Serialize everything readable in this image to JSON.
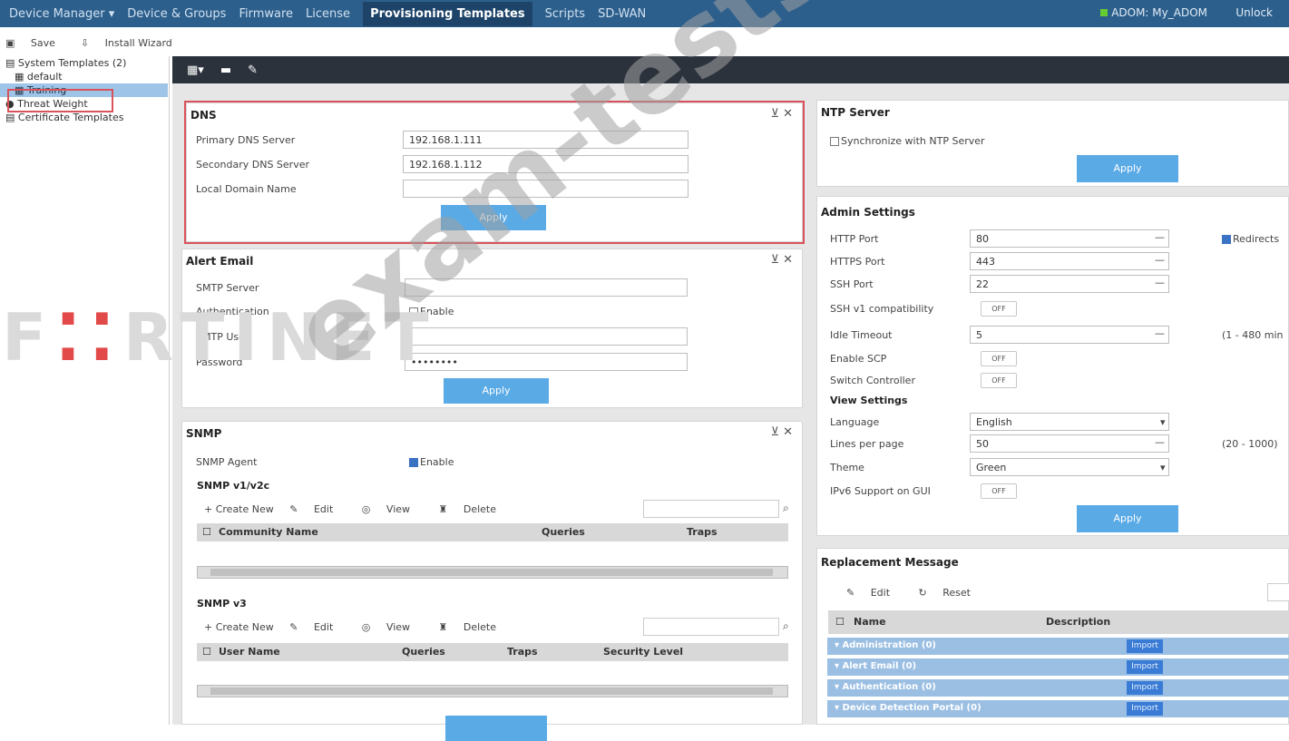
{
  "topnav": {
    "items": [
      "Device Manager ▾",
      "Device & Groups",
      "Firmware",
      "License",
      "Provisioning Templates",
      "Scripts",
      "SD-WAN"
    ],
    "active_index": 4,
    "adom": "ADOM: My_ADOM",
    "unlock": "Unlock"
  },
  "actions": {
    "save": "Save",
    "install": "Install Wizard"
  },
  "tree": {
    "items": [
      "System Templates (2)",
      "default",
      "Training",
      "Threat Weight",
      "Certificate Templates"
    ],
    "selected_index": 2
  },
  "dns": {
    "title": "DNS",
    "primary_label": "Primary DNS Server",
    "primary_value": "192.168.1.111",
    "secondary_label": "Secondary DNS Server",
    "secondary_value": "192.168.1.112",
    "domain_label": "Local Domain Name",
    "domain_value": "",
    "apply": "Apply"
  },
  "alert": {
    "title": "Alert Email",
    "smtp_label": "SMTP Server",
    "auth_label": "Authentication",
    "auth_check": "Enable",
    "user_label": "SMTP User",
    "password_label": "Password",
    "password_value": "••••••••",
    "apply": "Apply"
  },
  "snmp": {
    "title": "SNMP",
    "agent_label": "SNMP Agent",
    "agent_check": "Enable",
    "v12_title": "SNMP v1/v2c",
    "toolbar": [
      "+ Create New",
      "Edit",
      "View",
      "Delete"
    ],
    "v12_cols": [
      "Community Name",
      "Queries",
      "Traps"
    ],
    "v3_title": "SNMP v3",
    "v3_cols": [
      "User Name",
      "Queries",
      "Traps",
      "Security Level"
    ]
  },
  "ntp": {
    "title": "NTP Server",
    "sync_label": "Synchronize with NTP Server",
    "apply": "Apply"
  },
  "admin": {
    "title": "Admin Settings",
    "http_label": "HTTP Port",
    "http_value": "80",
    "redirect_label": "Redirects",
    "https_label": "HTTPS Port",
    "https_value": "443",
    "ssh_label": "SSH Port",
    "ssh_value": "22",
    "sshv1_label": "SSH v1 compatibility",
    "off": "OFF",
    "idle_label": "Idle Timeout",
    "idle_value": "5",
    "idle_range": "(1 - 480 min",
    "scp_label": "Enable SCP",
    "switch_label": "Switch Controller",
    "view_title": "View Settings",
    "lang_label": "Language",
    "lang_value": "English",
    "lines_label": "Lines per page",
    "lines_value": "50",
    "lines_range": "(20 - 1000)",
    "theme_label": "Theme",
    "theme_value": "Green",
    "ipv6_label": "IPv6 Support on GUI",
    "apply": "Apply"
  },
  "replacement": {
    "title": "Replacement Message",
    "edit": "Edit",
    "reset": "Reset",
    "cols": [
      "Name",
      "Description"
    ],
    "rows": [
      "Administration (0)",
      "Alert Email (0)",
      "Authentication (0)",
      "Device Detection Portal (0)"
    ],
    "import": "Import"
  },
  "overlay": {
    "watermark": "exam-tests.com",
    "logo_left": "F",
    "logo_mid": "⁚⁚",
    "logo_right": "RTINET"
  },
  "colors": {
    "accent": "#5aaae6",
    "nav": "#2d5f8c",
    "highlight": "#d9535a"
  }
}
